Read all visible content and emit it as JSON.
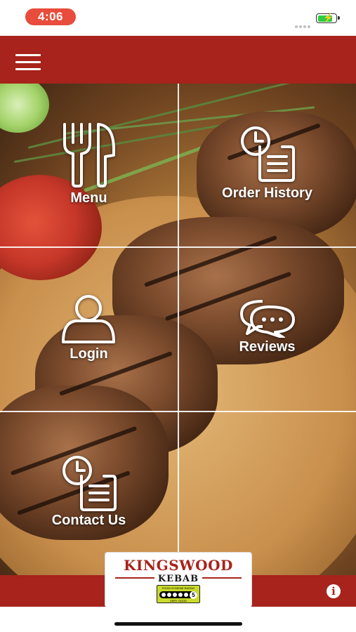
{
  "status_bar": {
    "time": "4:06",
    "time_pill_color": "#e74c3c",
    "battery_level_fraction": 0.85,
    "battery_color": "#2ecc40",
    "battery_icon": "battery-charging-icon"
  },
  "header": {
    "background_color": "#a7231c",
    "menu_icon": "hamburger-menu-icon"
  },
  "tiles": [
    {
      "label": "Menu",
      "icon": "fork-knife-icon"
    },
    {
      "label": "Order History",
      "icon": "order-history-icon"
    },
    {
      "label": "Login",
      "icon": "user-icon"
    },
    {
      "label": "Reviews",
      "icon": "chat-bubbles-icon"
    },
    {
      "label": "Contact Us",
      "icon": "contact-clipboard-icon"
    }
  ],
  "footer": {
    "background_color": "#a7231c",
    "info_icon": "info-icon",
    "info_glyph": "i"
  },
  "logo": {
    "title": "KINGSWOOD",
    "subtitle": "KEBAB",
    "hygiene_rating_top": "FOOD HYGIENE RATING",
    "hygiene_rating_value": "5",
    "hygiene_rating_bottom": "VERY GOOD",
    "brand_color": "#a7231c",
    "hygiene_badge_color": "#c9da2b"
  }
}
